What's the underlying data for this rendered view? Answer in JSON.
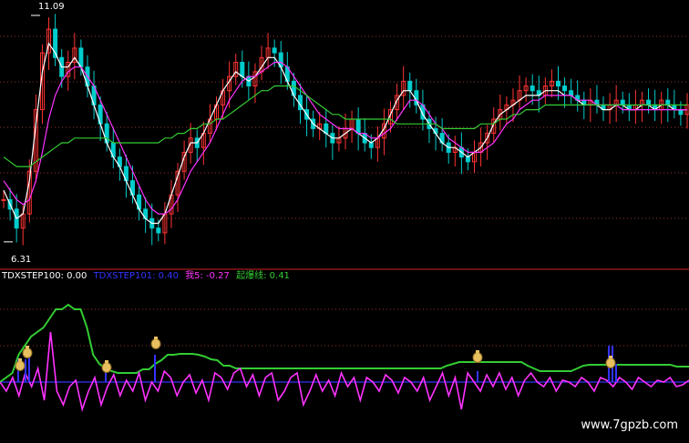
{
  "chart_data": [
    {
      "type": "line",
      "panel": "price",
      "title": "",
      "high_label": "11.09",
      "low_label": "6.31",
      "high_value": 11.09,
      "low_value": 6.31,
      "ylim": [
        6.0,
        11.3
      ],
      "grid": true,
      "series": [
        {
          "kind": "candles",
          "values": [
            7.2,
            7.0,
            6.6,
            6.9,
            7.8,
            9.1,
            10.3,
            10.8,
            10.2,
            9.8,
            10.1,
            10.4,
            10.0,
            9.6,
            9.2,
            8.8,
            8.4,
            8.1,
            7.9,
            7.6,
            7.3,
            7.0,
            6.8,
            6.6,
            6.5,
            6.9,
            7.3,
            7.8,
            8.2,
            8.5,
            8.3,
            8.6,
            8.9,
            9.2,
            9.5,
            9.8,
            10.1,
            9.8,
            9.6,
            9.9,
            10.2,
            10.4,
            10.3,
            10.0,
            9.7,
            9.4,
            9.1,
            8.9,
            8.7,
            8.8,
            8.6,
            8.4,
            8.5,
            8.7,
            8.9,
            8.6,
            8.4,
            8.3,
            8.5,
            8.8,
            9.1,
            9.4,
            9.7,
            9.5,
            9.2,
            8.9,
            8.7,
            8.6,
            8.4,
            8.2,
            8.3,
            8.1,
            8.0,
            8.2,
            8.4,
            8.6,
            8.9,
            9.1,
            9.2,
            9.3,
            9.5,
            9.6,
            9.5,
            9.4,
            9.6,
            9.7,
            9.6,
            9.5,
            9.4,
            9.3,
            9.2,
            9.3,
            9.2,
            9.1,
            9.2,
            9.3,
            9.2,
            9.1,
            9.2,
            9.3,
            9.2,
            9.1,
            9.3,
            9.2,
            9.1,
            9.0,
            9.2
          ]
        },
        {
          "name": "",
          "color": "#ffffff",
          "values": [
            7.4,
            7.1,
            6.8,
            6.9,
            7.6,
            8.8,
            9.9,
            10.5,
            10.3,
            10.0,
            10.0,
            10.2,
            10.0,
            9.6,
            9.2,
            8.8,
            8.4,
            8.1,
            7.9,
            7.6,
            7.3,
            7.0,
            6.8,
            6.7,
            6.7,
            6.9,
            7.3,
            7.7,
            8.1,
            8.4,
            8.4,
            8.6,
            8.9,
            9.2,
            9.5,
            9.7,
            9.9,
            9.8,
            9.7,
            9.8,
            10.0,
            10.2,
            10.2,
            10.0,
            9.7,
            9.4,
            9.2,
            9.0,
            8.8,
            8.7,
            8.6,
            8.5,
            8.5,
            8.6,
            8.7,
            8.6,
            8.5,
            8.4,
            8.5,
            8.7,
            9.0,
            9.3,
            9.5,
            9.5,
            9.3,
            9.0,
            8.8,
            8.6,
            8.4,
            8.3,
            8.3,
            8.2,
            8.1,
            8.2,
            8.3,
            8.5,
            8.8,
            9.0,
            9.1,
            9.2,
            9.3,
            9.4,
            9.4,
            9.4,
            9.5,
            9.5,
            9.5,
            9.4,
            9.4,
            9.3,
            9.2,
            9.2,
            9.2,
            9.1,
            9.1,
            9.2,
            9.2,
            9.1,
            9.1,
            9.2,
            9.2,
            9.1,
            9.2,
            9.2,
            9.1,
            9.1,
            9.1
          ]
        },
        {
          "name": "",
          "color": "#ff33ff",
          "values": [
            7.6,
            7.4,
            7.2,
            7.1,
            7.2,
            7.6,
            8.2,
            8.9,
            9.4,
            9.7,
            9.9,
            10.0,
            10.0,
            9.8,
            9.6,
            9.3,
            9.0,
            8.7,
            8.4,
            8.1,
            7.8,
            7.5,
            7.2,
            7.0,
            6.9,
            6.9,
            7.0,
            7.2,
            7.5,
            7.8,
            8.0,
            8.2,
            8.4,
            8.7,
            9.0,
            9.3,
            9.5,
            9.7,
            9.8,
            9.8,
            9.9,
            10.0,
            10.1,
            10.1,
            10.0,
            9.8,
            9.6,
            9.4,
            9.2,
            9.0,
            8.9,
            8.8,
            8.7,
            8.7,
            8.7,
            8.6,
            8.6,
            8.5,
            8.5,
            8.6,
            8.7,
            8.9,
            9.1,
            9.3,
            9.3,
            9.2,
            9.0,
            8.8,
            8.7,
            8.5,
            8.4,
            8.3,
            8.2,
            8.2,
            8.2,
            8.3,
            8.4,
            8.6,
            8.8,
            8.9,
            9.1,
            9.2,
            9.3,
            9.3,
            9.4,
            9.4,
            9.4,
            9.4,
            9.4,
            9.3,
            9.3,
            9.3,
            9.2,
            9.2,
            9.2,
            9.2,
            9.1,
            9.1,
            9.1,
            9.1,
            9.1,
            9.1,
            9.1,
            9.1,
            9.1,
            9.1,
            9.1
          ]
        },
        {
          "name": "",
          "color": "#33cc33",
          "values": [
            8.1,
            8.0,
            7.9,
            7.9,
            7.9,
            8.0,
            8.1,
            8.2,
            8.3,
            8.4,
            8.4,
            8.5,
            8.5,
            8.5,
            8.5,
            8.5,
            8.5,
            8.4,
            8.4,
            8.4,
            8.4,
            8.4,
            8.4,
            8.4,
            8.4,
            8.5,
            8.5,
            8.6,
            8.6,
            8.7,
            8.7,
            8.8,
            8.8,
            8.9,
            8.9,
            9.0,
            9.1,
            9.2,
            9.3,
            9.4,
            9.5,
            9.5,
            9.6,
            9.6,
            9.6,
            9.6,
            9.5,
            9.4,
            9.3,
            9.2,
            9.1,
            9.0,
            9.0,
            8.9,
            8.9,
            8.9,
            8.9,
            8.9,
            8.9,
            8.9,
            8.9,
            8.8,
            8.8,
            8.8,
            8.8,
            8.8,
            8.8,
            8.8,
            8.7,
            8.7,
            8.7,
            8.7,
            8.7,
            8.7,
            8.8,
            8.8,
            8.8,
            8.9,
            8.9,
            9.0,
            9.0,
            9.1,
            9.1,
            9.1,
            9.2,
            9.2,
            9.2,
            9.2,
            9.2,
            9.2,
            9.2,
            9.2,
            9.2,
            9.2,
            9.2,
            9.2,
            9.2,
            9.2,
            9.2,
            9.2,
            9.2,
            9.2,
            9.2,
            9.2,
            9.2,
            9.2,
            9.2
          ]
        }
      ]
    },
    {
      "type": "line",
      "panel": "indicator",
      "legend": [
        {
          "text": "TDXSTEP100: 0.00",
          "color": "#ffffff"
        },
        {
          "text": "TDXSTEP101: 0.40",
          "color": "#3333ff"
        },
        {
          "text": "我5: -0.27",
          "color": "#ff33ff"
        },
        {
          "text": "起爆线: 0.41",
          "color": "#33cc33"
        }
      ],
      "ylim": [
        -0.6,
        1.1
      ],
      "grid": true,
      "series": [
        {
          "name": "起爆线",
          "color": "#33cc33",
          "values": [
            0.0,
            0.05,
            0.1,
            0.3,
            0.4,
            0.5,
            0.55,
            0.6,
            0.7,
            0.8,
            0.8,
            0.85,
            0.8,
            0.8,
            0.6,
            0.3,
            0.2,
            0.15,
            0.12,
            0.1,
            0.1,
            0.1,
            0.1,
            0.14,
            0.14,
            0.2,
            0.24,
            0.3,
            0.3,
            0.31,
            0.31,
            0.31,
            0.3,
            0.28,
            0.25,
            0.24,
            0.18,
            0.18,
            0.15,
            0.15,
            0.15,
            0.15,
            0.15,
            0.15,
            0.15,
            0.15,
            0.15,
            0.15,
            0.15,
            0.15,
            0.15,
            0.15,
            0.15,
            0.15,
            0.15,
            0.15,
            0.15,
            0.15,
            0.15,
            0.15,
            0.15,
            0.15,
            0.15,
            0.15,
            0.15,
            0.15,
            0.15,
            0.15,
            0.15,
            0.15,
            0.15,
            0.15,
            0.18,
            0.2,
            0.22,
            0.22,
            0.22,
            0.22,
            0.22,
            0.22,
            0.22,
            0.22,
            0.22,
            0.22,
            0.22,
            0.18,
            0.15,
            0.12,
            0.12,
            0.12,
            0.12,
            0.12,
            0.12,
            0.15,
            0.18,
            0.19,
            0.19,
            0.19,
            0.19,
            0.19,
            0.19,
            0.19,
            0.19,
            0.19,
            0.19,
            0.19,
            0.19,
            0.19,
            0.19,
            0.17,
            0.17,
            0.17
          ]
        },
        {
          "name": "我5",
          "color": "#ff33ff",
          "values": [
            0.0,
            -0.1,
            0.05,
            -0.15,
            0.1,
            -0.05,
            0.15,
            -0.2,
            0.55,
            -0.1,
            -0.25,
            -0.05,
            0.02,
            -0.3,
            -0.1,
            0.05,
            -0.25,
            -0.05,
            0.08,
            -0.15,
            0.02,
            -0.1,
            0.1,
            -0.2,
            0.0,
            -0.1,
            0.12,
            0.05,
            -0.15,
            0.0,
            0.08,
            -0.12,
            0.02,
            -0.2,
            0.1,
            0.05,
            -0.08,
            0.1,
            0.15,
            -0.05,
            0.08,
            -0.15,
            0.05,
            0.1,
            -0.2,
            -0.1,
            0.05,
            0.1,
            -0.25,
            -0.1,
            0.08,
            -0.1,
            0.02,
            -0.15,
            0.1,
            -0.05,
            0.05,
            -0.2,
            0.05,
            0.0,
            -0.1,
            0.08,
            0.02,
            -0.12,
            0.05,
            0.0,
            -0.1,
            0.05,
            -0.2,
            -0.05,
            0.1,
            -0.15,
            0.05,
            -0.3,
            0.1,
            0.0,
            -0.1,
            0.08,
            -0.05,
            0.1,
            -0.08,
            0.05,
            -0.15,
            0.02,
            0.1,
            0.0,
            -0.05,
            0.05,
            -0.1,
            0.02,
            0.0,
            -0.05,
            0.05,
            0.0,
            -0.1,
            0.05,
            0.02,
            -0.05,
            0.05,
            0.0,
            -0.08,
            0.05,
            0.0,
            -0.05,
            0.02,
            0.0,
            0.05,
            -0.05,
            -0.03,
            0.02
          ]
        },
        {
          "name": "TDXSTEP101",
          "color": "#3333ff",
          "kind": "spikes",
          "baseline": 0.0,
          "values": [
            0.25,
            0.25,
            0.3,
            0.12,
            0.3,
            0.12,
            0.4,
            0.4,
            0.2
          ]
        }
      ],
      "signal_icon": "money-bag-icon",
      "signal_count": 9
    }
  ],
  "watermark": "www.7gpzb.com",
  "colors": {
    "background": "#000000",
    "up": "#ff3333",
    "down": "#00cccc",
    "divider": "#cc2222",
    "grid": "#993333"
  }
}
